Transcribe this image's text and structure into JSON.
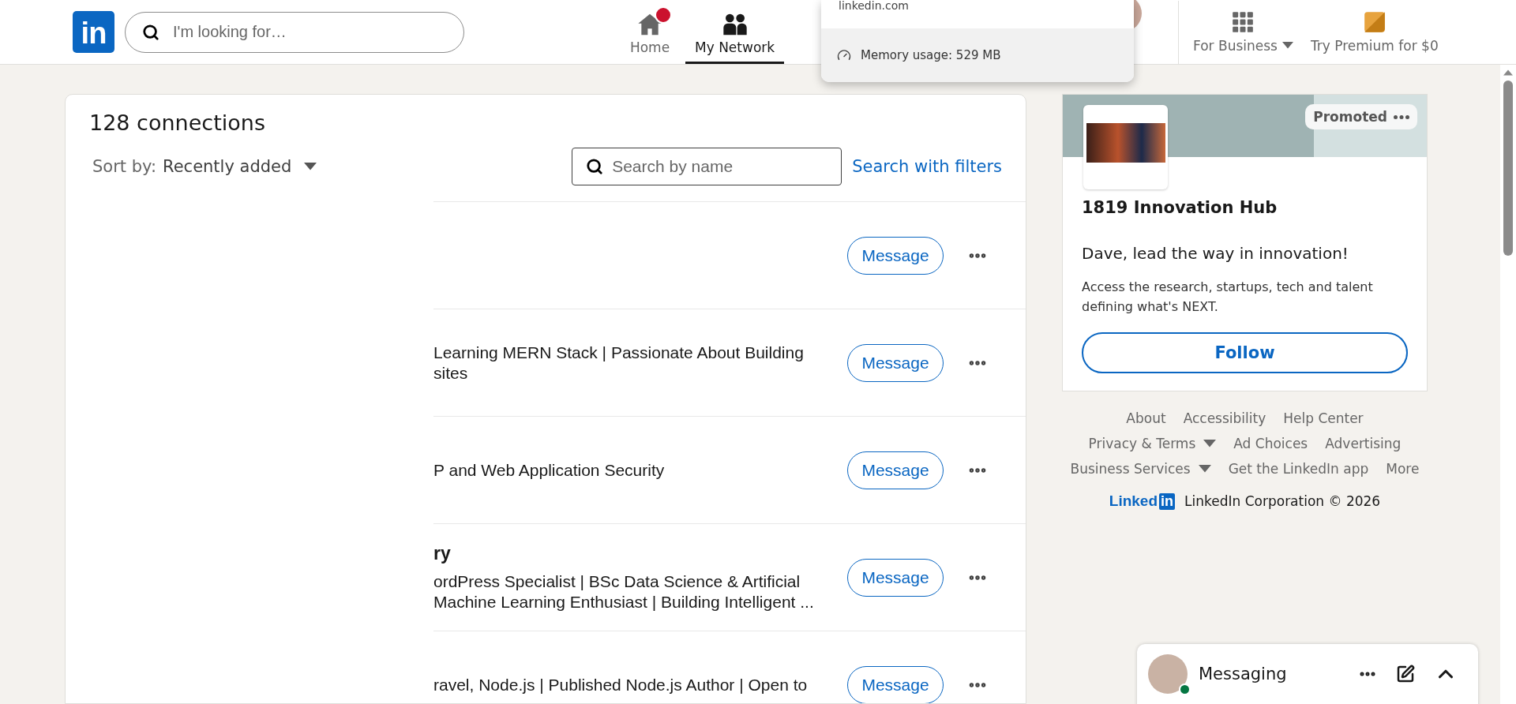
{
  "nav": {
    "logo": "in",
    "search": {
      "placeholder": "I'm looking for…"
    },
    "items": [
      {
        "kind": "home",
        "label": "Home",
        "selected": false,
        "badge": true
      },
      {
        "kind": "network",
        "label": "My Network",
        "selected": true,
        "badge": false
      }
    ],
    "business": "For Business",
    "premium": "Try Premium for $0"
  },
  "popup": {
    "site": "linkedin.com",
    "memory": "Memory usage: 529 MB"
  },
  "connections": {
    "title": "128 connections",
    "sort_label": "Sort by:",
    "sort_value": "Recently added",
    "search": {
      "placeholder": "Search by name"
    },
    "filters_link": "Search with filters",
    "rows": [
      {
        "action": "Message"
      },
      {
        "lines": [
          "Learning MERN Stack | Passionate About Building",
          "sites"
        ],
        "action": "Message"
      },
      {
        "lines": [
          "P and Web Application Security"
        ],
        "action": "Message"
      },
      {
        "name": "ry",
        "lines": [
          "ordPress Specialist | BSc Data Science & Artificial",
          "Machine Learning Enthusiast | Building Intelligent ..."
        ],
        "action": "Message"
      },
      {
        "lines": [
          "ravel, Node.js | Published Node.js Author | Open to"
        ],
        "action": "Message"
      }
    ]
  },
  "ad": {
    "promoted": "Promoted",
    "company": "1819 Innovation Hub",
    "tagline": "Dave, lead the way in innovation!",
    "description": "Access the research, startups, tech and talent defining what's NEXT.",
    "button": "Follow"
  },
  "footer": {
    "links": [
      [
        {
          "label": "About",
          "dropdown": false
        },
        {
          "label": "Accessibility",
          "dropdown": false
        },
        {
          "label": "Help Center",
          "dropdown": false
        }
      ],
      [
        {
          "label": "Privacy & Terms",
          "dropdown": true
        },
        {
          "label": "Ad Choices",
          "dropdown": false
        },
        {
          "label": "Advertising",
          "dropdown": false
        }
      ],
      [
        {
          "label": "Business Services",
          "dropdown": true
        },
        {
          "label": "Get the LinkedIn app",
          "dropdown": false
        },
        {
          "label": "More",
          "dropdown": false
        }
      ]
    ],
    "brand_word": "Linked",
    "brand_box": "in",
    "copyright": "LinkedIn Corporation © 2026"
  },
  "messaging": {
    "title": "Messaging",
    "online": true
  }
}
